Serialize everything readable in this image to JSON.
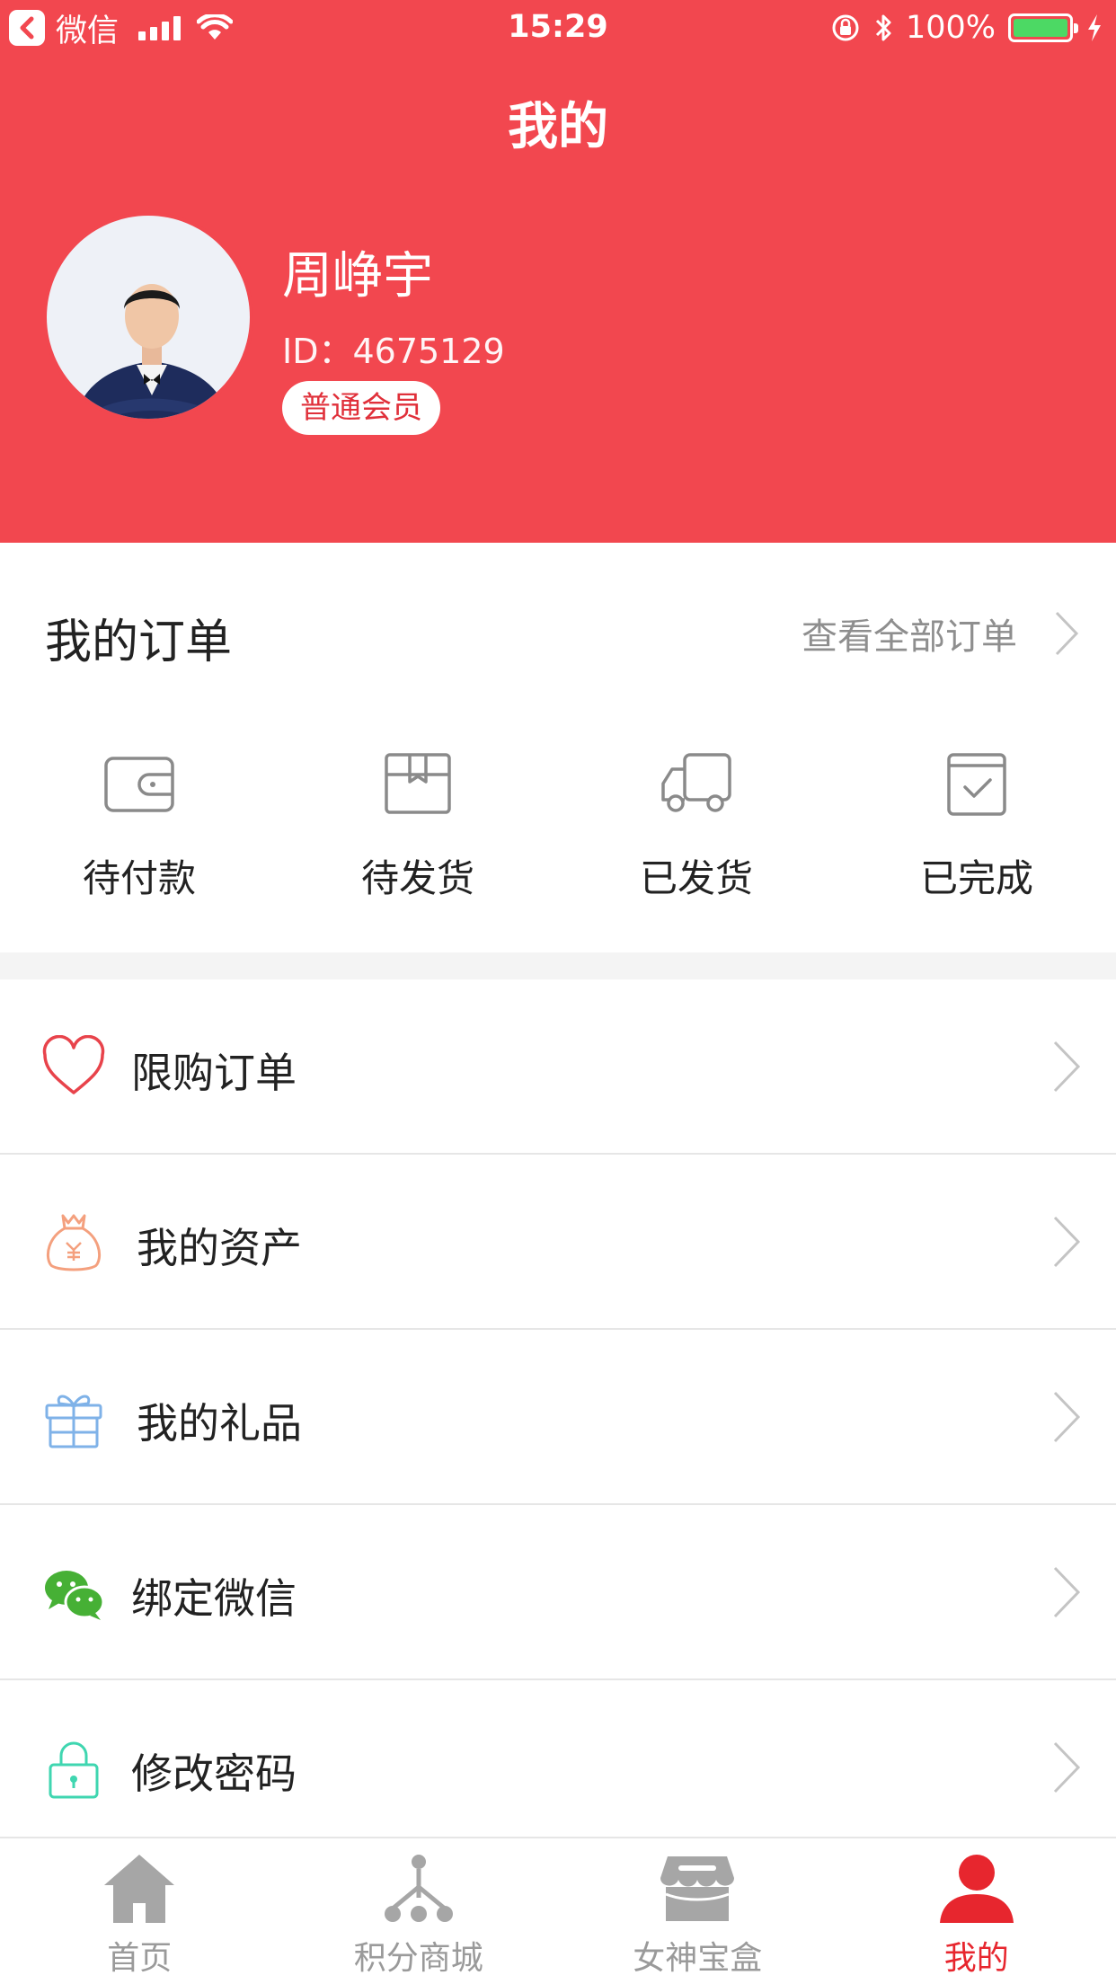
{
  "status_bar": {
    "carrier": "微信",
    "time": "15:29",
    "battery": "100%",
    "battery_level": 1.0
  },
  "header": {
    "title": "我的",
    "background": "#f2474f"
  },
  "profile": {
    "name": "周峥宇",
    "id_text": "ID：4675129",
    "member_level": "普通会员"
  },
  "orders": {
    "title": "我的订单",
    "view_all": "查看全部订单",
    "items": [
      {
        "label": "待付款",
        "icon": "wallet-icon"
      },
      {
        "label": "待发货",
        "icon": "package-icon"
      },
      {
        "label": "已发货",
        "icon": "truck-icon"
      },
      {
        "label": "已完成",
        "icon": "completed-icon"
      }
    ]
  },
  "menu": {
    "items": [
      {
        "label": "限购订单",
        "icon": "heart-icon",
        "color": "#e8434b"
      },
      {
        "label": "我的资产",
        "icon": "money-bag-icon",
        "color": "#f4a07e"
      },
      {
        "label": "我的礼品",
        "icon": "gift-icon",
        "color": "#7fb2e8"
      },
      {
        "label": "绑定微信",
        "icon": "wechat-icon",
        "color": "#46b035"
      },
      {
        "label": "修改密码",
        "icon": "lock-icon",
        "color": "#3fd6b0"
      }
    ]
  },
  "tabbar": {
    "items": [
      {
        "label": "首页",
        "icon": "home-icon",
        "active": false
      },
      {
        "label": "积分商城",
        "icon": "points-mall-icon",
        "active": false
      },
      {
        "label": "女神宝盒",
        "icon": "store-icon",
        "active": false
      },
      {
        "label": "我的",
        "icon": "user-icon",
        "active": true
      }
    ],
    "active_color": "#e7262e",
    "inactive_color": "#9a9a9a"
  }
}
